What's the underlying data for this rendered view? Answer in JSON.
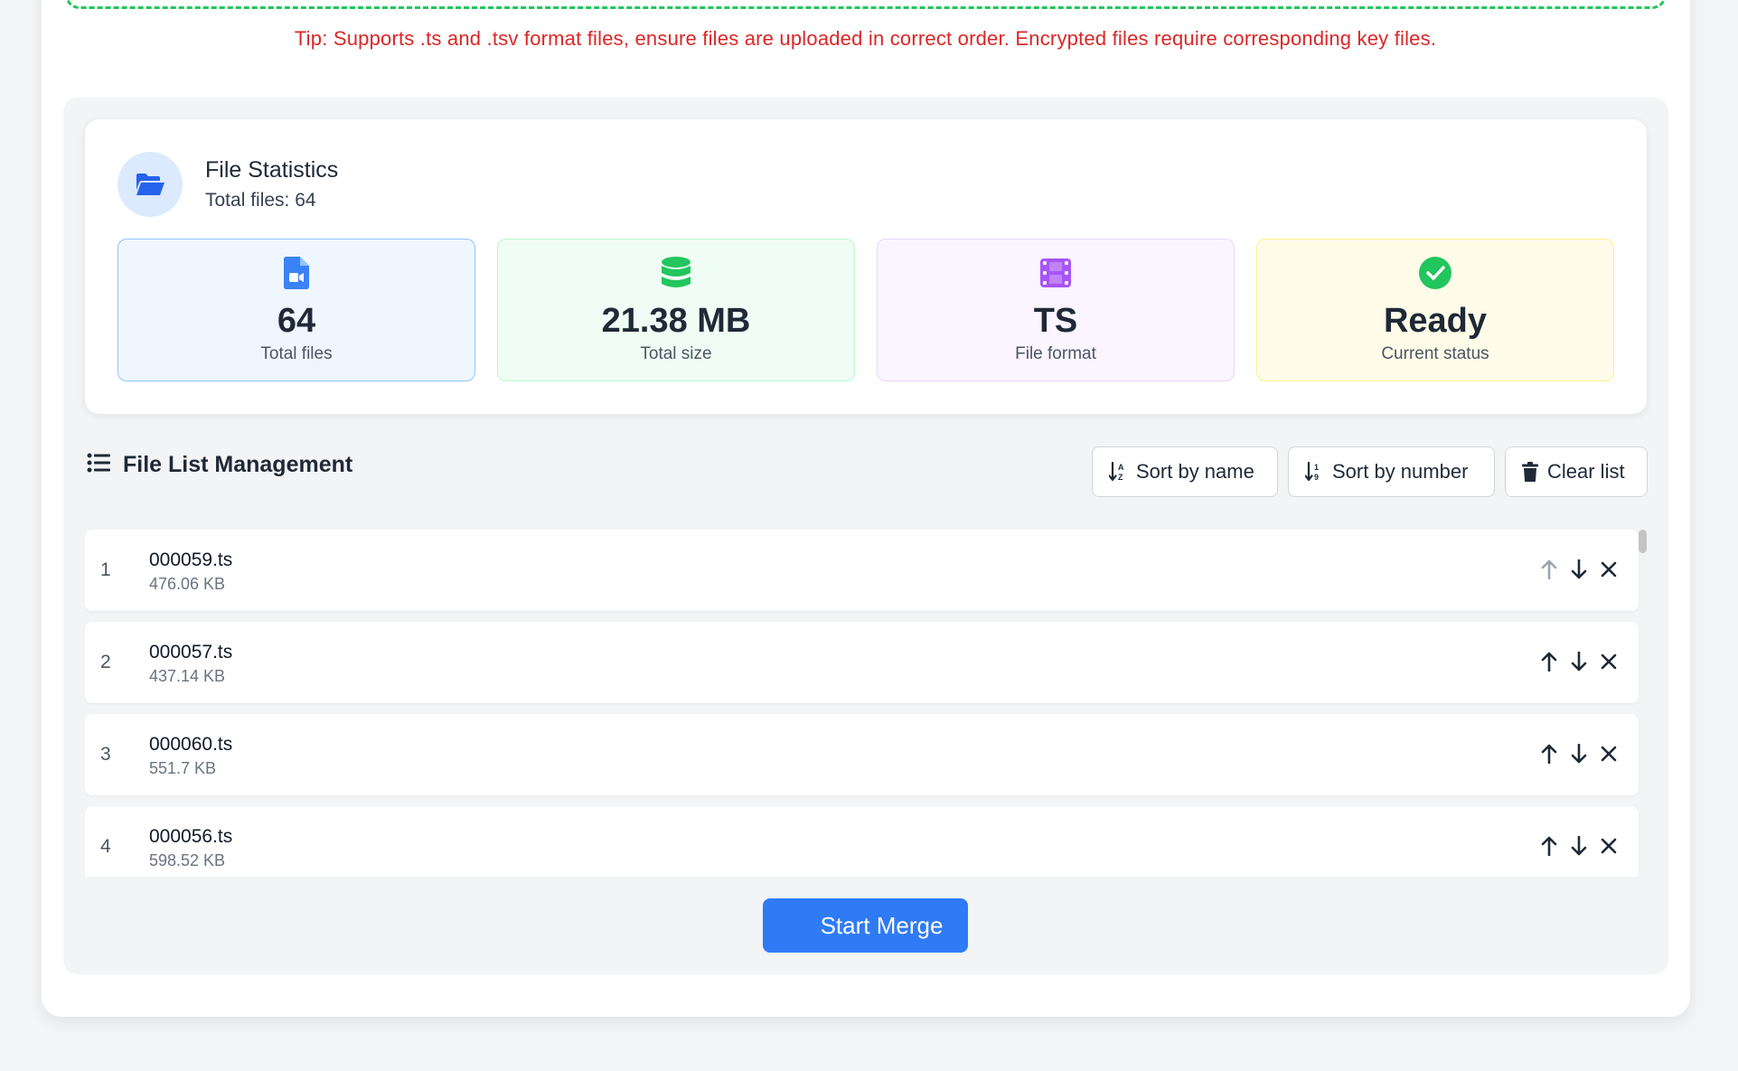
{
  "tip": "Tip: Supports .ts and .tsv format files, ensure files are uploaded in correct order. Encrypted files require corresponding key files.",
  "stats": {
    "title": "File Statistics",
    "subtitle": "Total files: 64",
    "boxes": [
      {
        "icon": "file-video-icon",
        "value": "64",
        "label": "Total files",
        "color": "#3b82f6"
      },
      {
        "icon": "database-icon",
        "value": "21.38 MB",
        "label": "Total size",
        "color": "#22c55e"
      },
      {
        "icon": "film-icon",
        "value": "TS",
        "label": "File format",
        "color": "#a855f7"
      },
      {
        "icon": "check-circle-icon",
        "value": "Ready",
        "label": "Current status",
        "color": "#22c55e"
      }
    ]
  },
  "list": {
    "title": "File List Management",
    "sort_name_label": "Sort by name",
    "sort_number_label": "Sort by number",
    "clear_label": "Clear list",
    "files": [
      {
        "index": "1",
        "name": "000059.ts",
        "size": "476.06 KB"
      },
      {
        "index": "2",
        "name": "000057.ts",
        "size": "437.14 KB"
      },
      {
        "index": "3",
        "name": "000060.ts",
        "size": "551.7 KB"
      },
      {
        "index": "4",
        "name": "000056.ts",
        "size": "598.52 KB"
      }
    ]
  },
  "merge_label": "Start Merge",
  "colors": {
    "accent": "#2f7bf5",
    "tip": "#dc2626",
    "dropzone_border": "#22c55e"
  }
}
